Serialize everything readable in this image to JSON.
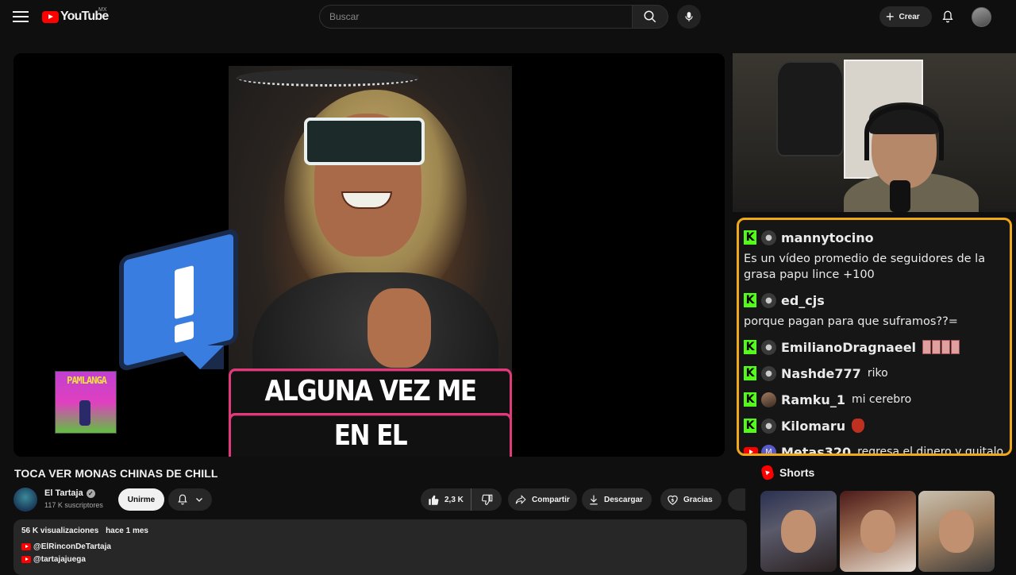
{
  "header": {
    "logo_text": "YouTube",
    "logo_region": "MX",
    "search_placeholder": "Buscar",
    "create_label": "Crear"
  },
  "video": {
    "caption_line1": "ALGUNA VEZ ME SENTÉ",
    "caption_line2": "EN EL PINOCHOCHOOO?",
    "badge_text": "PAMLANGA"
  },
  "chat": {
    "messages": [
      {
        "platform": "kick",
        "user": "mannytocino",
        "text": "Es un vídeo promedio de seguidores de la grasa papu lince +100"
      },
      {
        "platform": "kick",
        "user": "ed_cjs",
        "text": "porque pagan para que suframos??="
      },
      {
        "platform": "kick",
        "user": "EmilianoDragnaeel",
        "text": ""
      },
      {
        "platform": "kick",
        "user": "Nashde777",
        "text": "riko"
      },
      {
        "platform": "kick",
        "user": "Ramku_1",
        "text": "mi cerebro"
      },
      {
        "platform": "kick",
        "user": "Kilomaru",
        "text": ""
      },
      {
        "platform": "youtube",
        "user": "Metas320",
        "avatar_letter": "M",
        "text": "regresa el dinero y quitalo"
      }
    ]
  },
  "shorts": {
    "title": "Shorts"
  },
  "meta": {
    "title": "TOCA VER MONAS CHINAS DE CHILL",
    "channel_name": "El Tartaja",
    "subscribers": "117 K suscriptores",
    "join_label": "Unirme",
    "likes": "2,3 K",
    "share_label": "Compartir",
    "download_label": "Descargar",
    "thanks_label": "Gracias"
  },
  "description": {
    "views": "56 K visualizaciones",
    "date": "hace 1 mes",
    "links": [
      "@ElRinconDeTartaja",
      "@tartajajuega"
    ]
  },
  "colors": {
    "brand_red": "#ff0000",
    "kick_green": "#53fc18",
    "chat_border": "#f0a818",
    "background": "#0f0f0f"
  }
}
